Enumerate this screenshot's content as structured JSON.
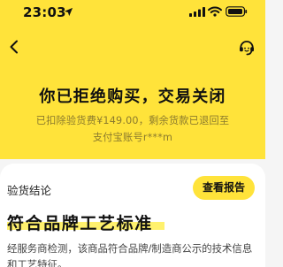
{
  "status_bar": {
    "time": "23:03"
  },
  "icons": {
    "location": "location-arrow-icon",
    "signal": "cellular-signal-icon",
    "wifi": "wifi-icon",
    "battery": "battery-icon",
    "back": "chevron-left-icon",
    "service": "customer-service-icon"
  },
  "colors": {
    "header_yellow": "#ffe33a",
    "highlight_yellow": "#fff16d",
    "refund_text": "#8b7a2d"
  },
  "order_status": {
    "headline": "你已拒绝购买，交易关闭",
    "refund_line_1": "已扣除验货费¥149.00，剩余货款已退回至",
    "refund_line_2": "支付宝账号r***m"
  },
  "inspection": {
    "section_label": "验货结论",
    "report_button": "查看报告",
    "verdict": "符合品牌工艺标准",
    "description_line_1": "经服务商检测，该商品符合品牌/制造商公示的技术信息",
    "description_line_2": "和工艺特征。"
  }
}
